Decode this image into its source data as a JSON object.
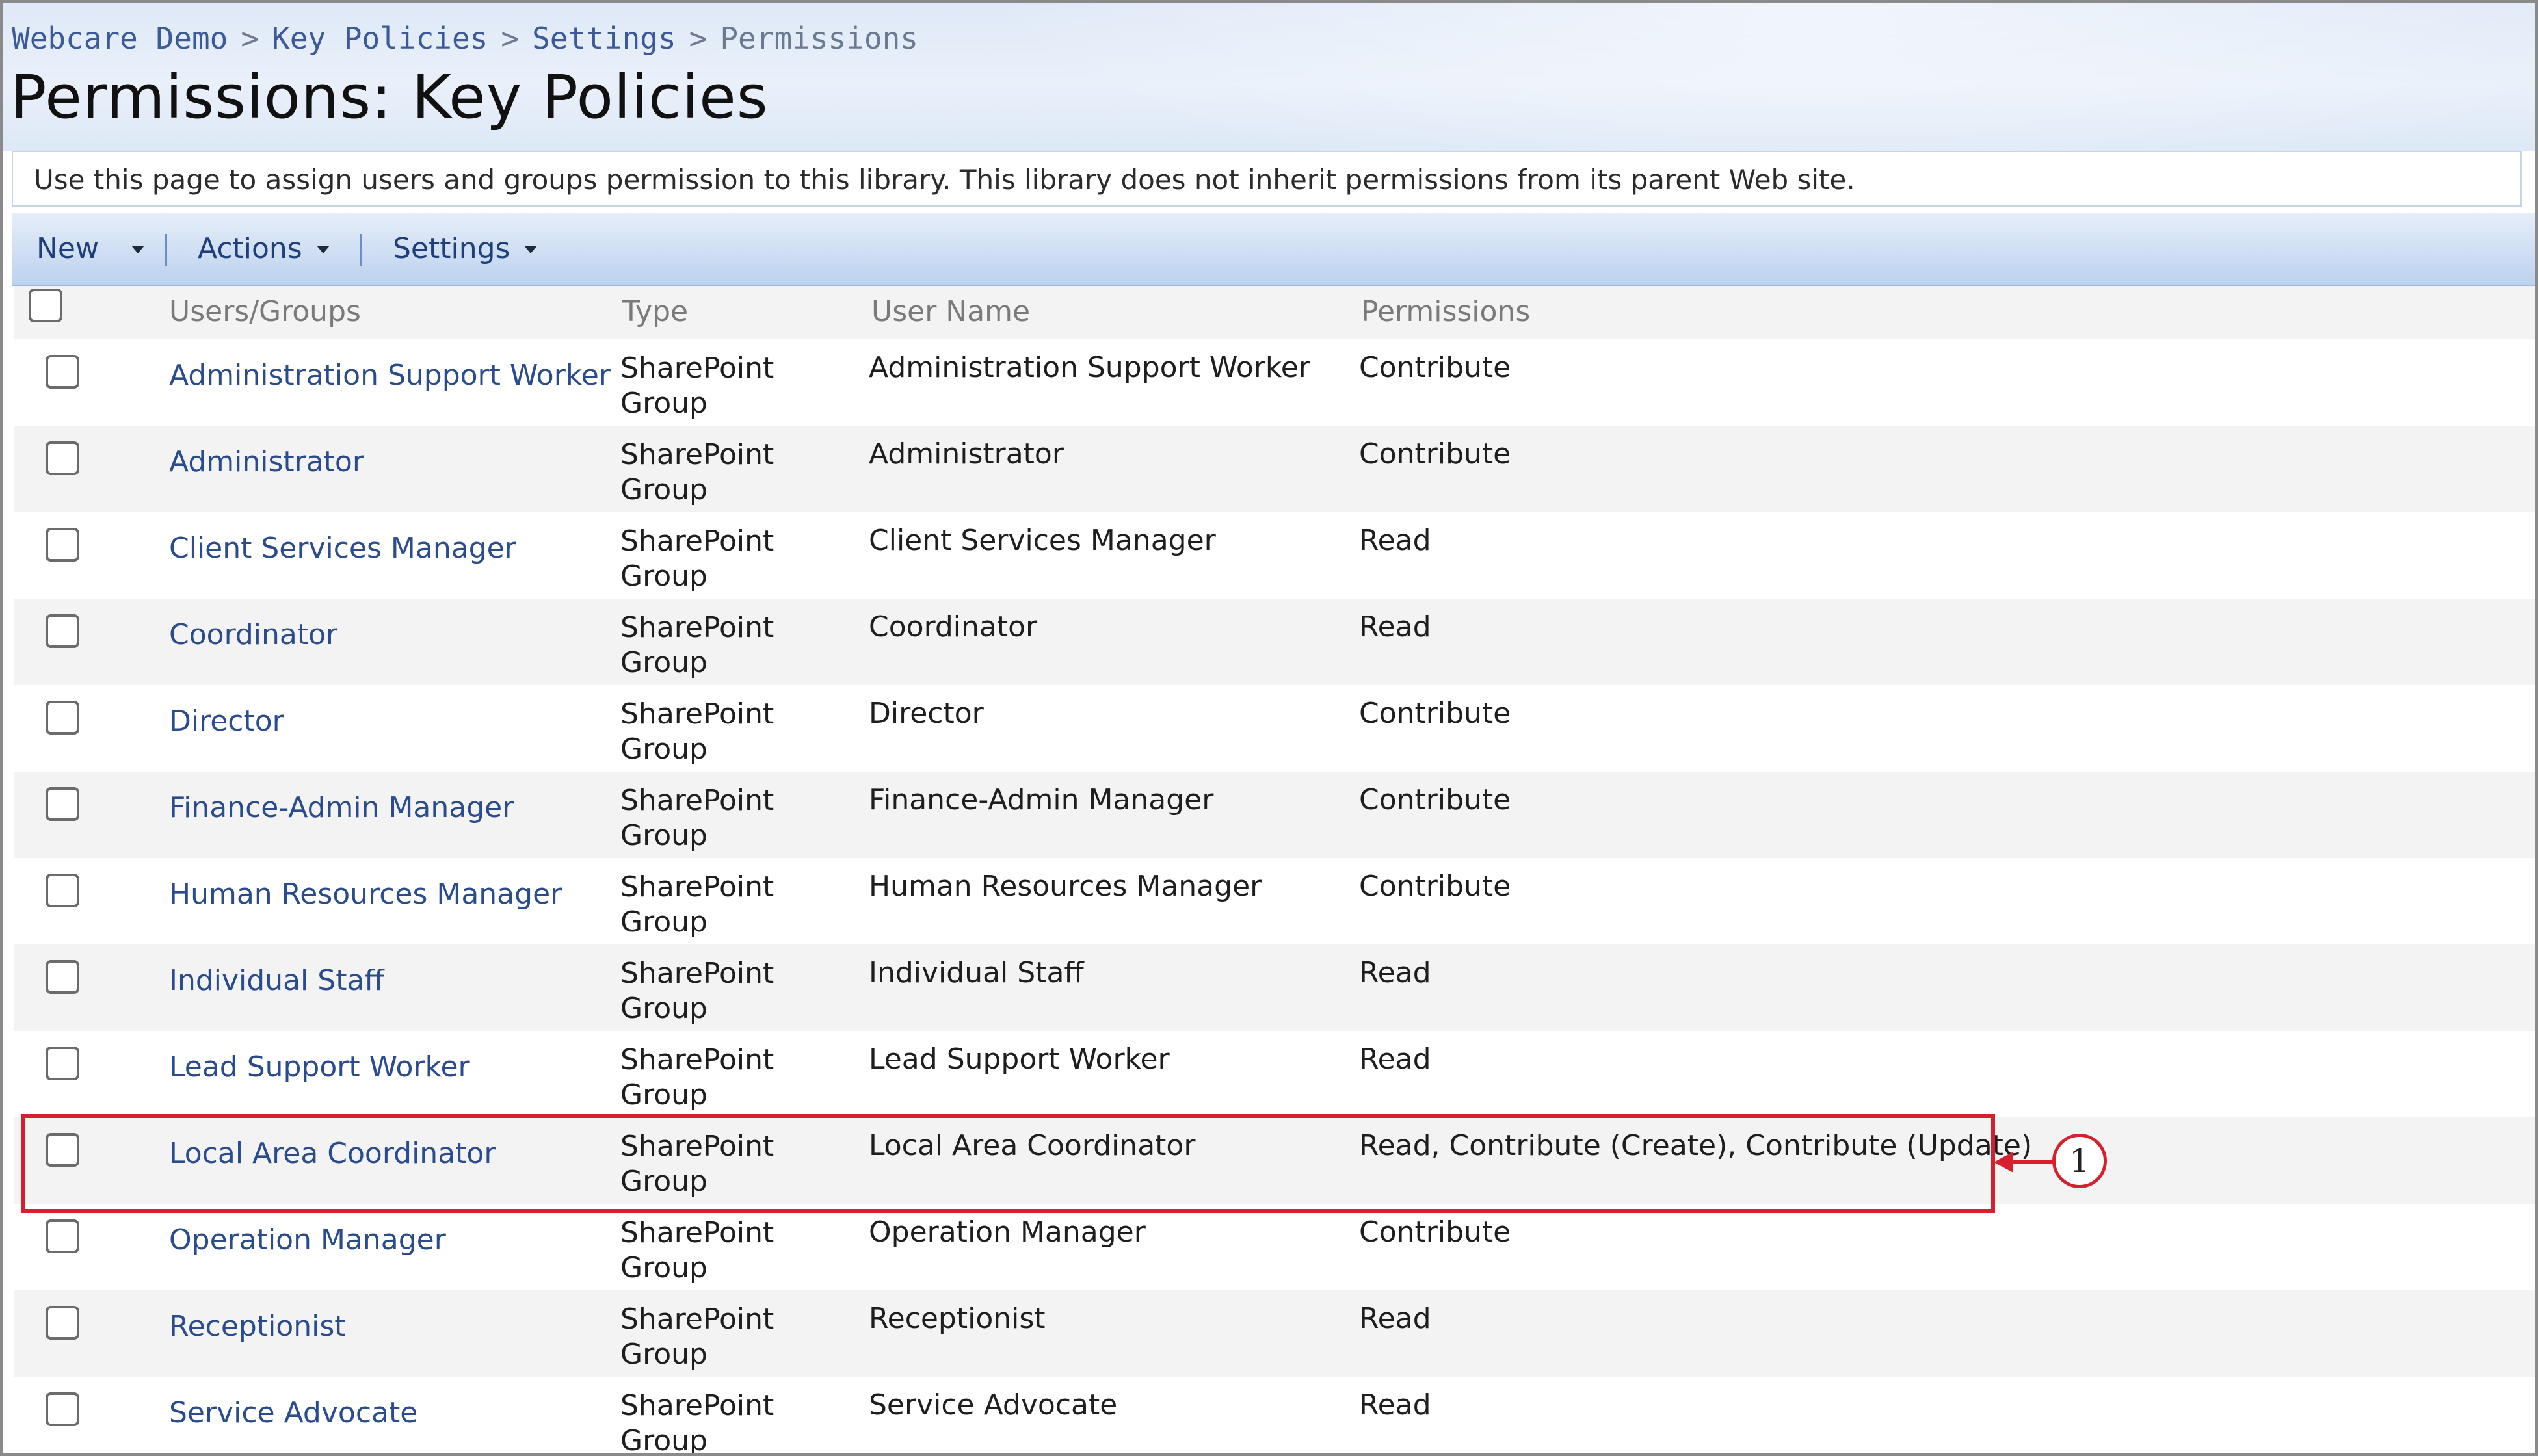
{
  "breadcrumb": {
    "items": [
      "Webcare Demo",
      "Key Policies",
      "Settings"
    ],
    "current": "Permissions",
    "separator": ">"
  },
  "page_title": "Permissions: Key Policies",
  "description": "Use this page to assign users and groups permission to this library. This library does not inherit permissions from its parent Web site.",
  "toolbar": {
    "new_label": "New",
    "actions_label": "Actions",
    "settings_label": "Settings"
  },
  "table": {
    "columns": [
      "Users/Groups",
      "Type",
      "User Name",
      "Permissions"
    ],
    "rows": [
      {
        "user": "Administration Support Worker",
        "type_line1": "SharePoint",
        "type_line2": "Group",
        "username": "Administration Support Worker",
        "permissions": "Contribute"
      },
      {
        "user": "Administrator",
        "type_line1": "SharePoint",
        "type_line2": "Group",
        "username": "Administrator",
        "permissions": "Contribute"
      },
      {
        "user": "Client Services Manager",
        "type_line1": "SharePoint",
        "type_line2": "Group",
        "username": "Client Services Manager",
        "permissions": "Read"
      },
      {
        "user": "Coordinator",
        "type_line1": "SharePoint",
        "type_line2": "Group",
        "username": "Coordinator",
        "permissions": "Read"
      },
      {
        "user": "Director",
        "type_line1": "SharePoint",
        "type_line2": "Group",
        "username": "Director",
        "permissions": "Contribute"
      },
      {
        "user": "Finance-Admin Manager",
        "type_line1": "SharePoint",
        "type_line2": "Group",
        "username": "Finance-Admin Manager",
        "permissions": "Contribute"
      },
      {
        "user": "Human Resources Manager",
        "type_line1": "SharePoint",
        "type_line2": "Group",
        "username": "Human Resources Manager",
        "permissions": "Contribute"
      },
      {
        "user": "Individual Staff",
        "type_line1": "SharePoint",
        "type_line2": "Group",
        "username": "Individual Staff",
        "permissions": "Read"
      },
      {
        "user": "Lead Support Worker",
        "type_line1": "SharePoint",
        "type_line2": "Group",
        "username": "Lead Support Worker",
        "permissions": "Read"
      },
      {
        "user": "Local Area Coordinator",
        "type_line1": "SharePoint",
        "type_line2": "Group",
        "username": "Local Area Coordinator",
        "permissions": "Read, Contribute (Create), Contribute (Update)"
      },
      {
        "user": "Operation Manager",
        "type_line1": "SharePoint",
        "type_line2": "Group",
        "username": "Operation Manager",
        "permissions": "Contribute"
      },
      {
        "user": "Receptionist",
        "type_line1": "SharePoint",
        "type_line2": "Group",
        "username": "Receptionist",
        "permissions": "Read"
      },
      {
        "user": "Service Advocate",
        "type_line1": "SharePoint",
        "type_line2": "Group",
        "username": "Service Advocate",
        "permissions": "Read"
      }
    ]
  },
  "callout": {
    "number": "1",
    "color": "#d6202e"
  },
  "colors": {
    "link": "#2a4c8c",
    "toolbar_text": "#1f3f78",
    "row_alt": "#f3f3f3"
  }
}
